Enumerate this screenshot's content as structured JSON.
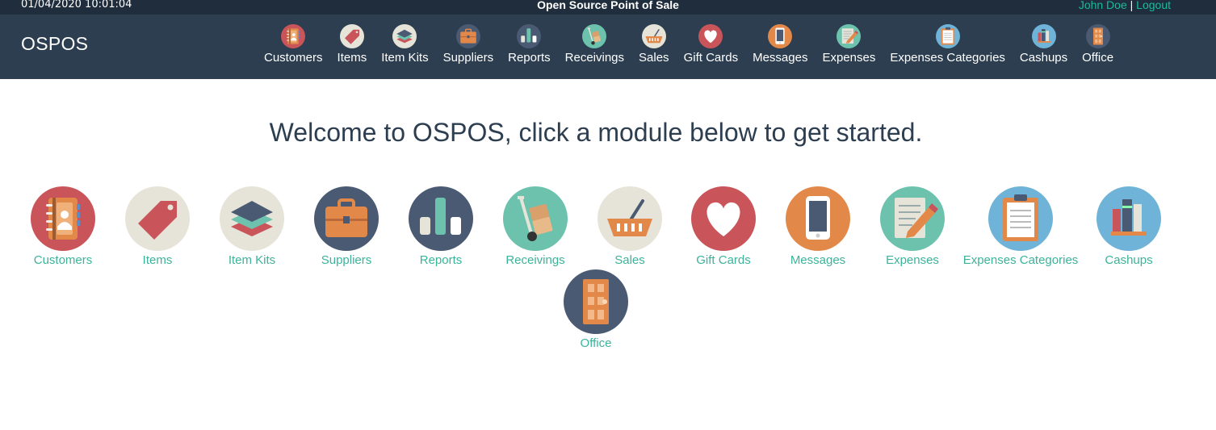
{
  "topbar": {
    "datetime": "01/04/2020 10:01:04",
    "app_title": "Open Source Point of Sale",
    "user_name": "John Doe",
    "separator": " | ",
    "logout": "Logout"
  },
  "navbar": {
    "brand": "OSPOS",
    "items": [
      {
        "label": "Customers",
        "icon": "customers-icon"
      },
      {
        "label": "Items",
        "icon": "items-icon"
      },
      {
        "label": "Item Kits",
        "icon": "item-kits-icon"
      },
      {
        "label": "Suppliers",
        "icon": "suppliers-icon"
      },
      {
        "label": "Reports",
        "icon": "reports-icon"
      },
      {
        "label": "Receivings",
        "icon": "receivings-icon"
      },
      {
        "label": "Sales",
        "icon": "sales-icon"
      },
      {
        "label": "Gift Cards",
        "icon": "gift-cards-icon"
      },
      {
        "label": "Messages",
        "icon": "messages-icon"
      },
      {
        "label": "Expenses",
        "icon": "expenses-icon"
      },
      {
        "label": "Expenses Categories",
        "icon": "expenses-categories-icon"
      },
      {
        "label": "Cashups",
        "icon": "cashups-icon"
      },
      {
        "label": "Office",
        "icon": "office-icon"
      }
    ]
  },
  "main": {
    "welcome": "Welcome to OSPOS, click a module below to get started.",
    "modules": [
      {
        "label": "Customers"
      },
      {
        "label": "Items"
      },
      {
        "label": "Item Kits"
      },
      {
        "label": "Suppliers"
      },
      {
        "label": "Reports"
      },
      {
        "label": "Receivings"
      },
      {
        "label": "Sales"
      },
      {
        "label": "Gift Cards"
      },
      {
        "label": "Messages"
      },
      {
        "label": "Expenses"
      },
      {
        "label": "Expenses Categories"
      },
      {
        "label": "Cashups"
      },
      {
        "label": "Office"
      }
    ]
  },
  "colors": {
    "topbar_bg": "#1f2d3d",
    "navbar_bg": "#2c3e50",
    "link_green": "#18bc9c",
    "module_label": "#3bb39b"
  }
}
